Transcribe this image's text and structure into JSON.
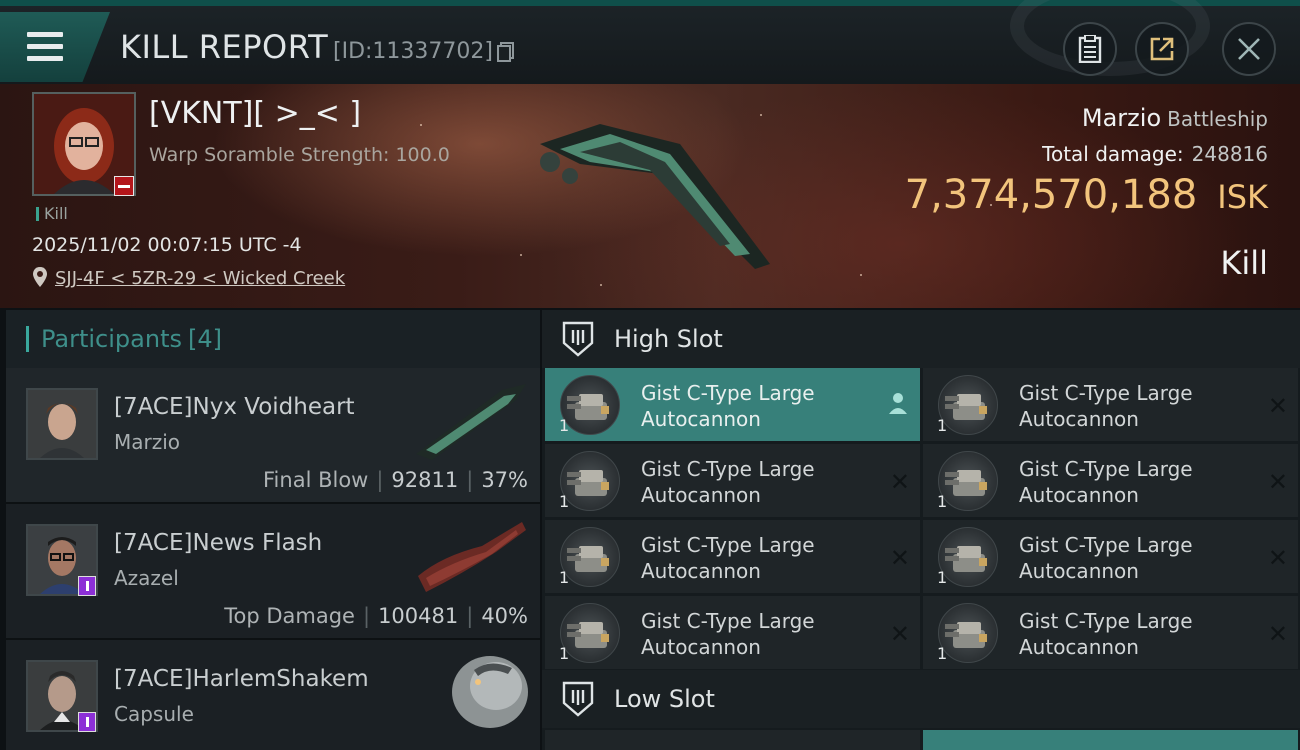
{
  "header": {
    "title": "KILL REPORT",
    "report_id": "[ID:11337702]"
  },
  "victim": {
    "name": "[VKNT][ >_< ]",
    "scramble": "Warp Soramble Strength: 100.0",
    "tag": "Kill",
    "datetime": "2025/11/02 00:07:15 UTC -4",
    "location": "SJJ-4F < 5ZR-29 < Wicked Creek",
    "ship": "Marzio",
    "ship_class": "Battleship",
    "total_damage_label": "Total damage:",
    "total_damage": "248816",
    "isk_value": "7,374,570,188",
    "isk_unit": "ISK",
    "result": "Kill"
  },
  "participants": {
    "title": "Participants",
    "count": "[4]",
    "rows": [
      {
        "name": "[7ACE]Nyx Voidheart",
        "ship": "Marzio",
        "label": "Final Blow",
        "damage": "92811",
        "percent": "37%"
      },
      {
        "name": "[7ACE]News Flash",
        "ship": "Azazel",
        "label": "Top Damage",
        "damage": "100481",
        "percent": "40%"
      },
      {
        "name": "[7ACE]HarlemShakem",
        "ship": "Capsule"
      }
    ]
  },
  "fitting": {
    "high_slot": "High Slot",
    "low_slot": "Low Slot",
    "module_line1": "Gist C-Type Large",
    "module_line2": "Autocannon",
    "qty": "1"
  }
}
